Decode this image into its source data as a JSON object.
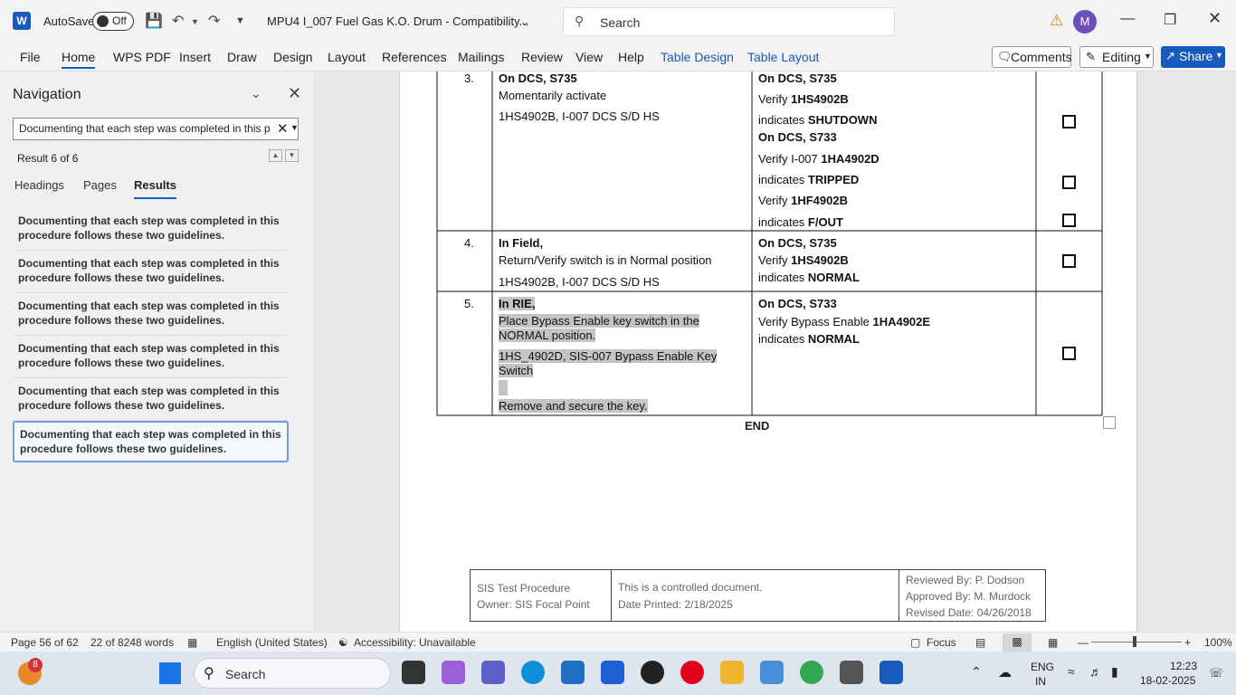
{
  "titlebar": {
    "autosave_label": "AutoSave",
    "toggle_state": "Off",
    "doc_title": "MPU4 I_007 Fuel Gas K.O. Drum  -  Compatibility...",
    "search_placeholder": "Search",
    "avatar_initial": "M"
  },
  "ribbon": {
    "tabs": [
      "File",
      "Home",
      "WPS PDF",
      "Insert",
      "Draw",
      "Design",
      "Layout",
      "References",
      "Mailings",
      "Review",
      "View",
      "Help",
      "Table Design",
      "Table Layout"
    ],
    "comments_label": "Comments",
    "editing_label": "Editing",
    "share_label": "Share"
  },
  "navigation": {
    "title": "Navigation",
    "search_value": "Documenting that each step was completed in this p",
    "result_count": "Result 6 of 6",
    "tabs": [
      "Headings",
      "Pages",
      "Results"
    ],
    "results": [
      "Documenting that each step was completed in this procedure follows these two guidelines.",
      "Documenting that each step was completed in this procedure follows these two guidelines.",
      "Documenting that each step was completed in this procedure follows these two guidelines.",
      "Documenting that each step was completed in this procedure follows these two guidelines.",
      "Documenting that each step was completed in this procedure follows these two guidelines.",
      "Documenting that each step was completed in this procedure follows these two guidelines."
    ]
  },
  "document": {
    "rows": [
      {
        "num": "3.",
        "action": [
          "On DCS, S735",
          "Momentarily activate",
          "1HS4902B, I-007 DCS S/D HS"
        ],
        "verify": [
          "On DCS, S735",
          "Verify ",
          "1HS4902B",
          " indicates ",
          "SHUTDOWN",
          "On DCS, S733",
          "Verify I-007 ",
          "1HA4902D",
          " indicates ",
          "TRIPPED",
          "Verify ",
          "1HF4902B",
          " indicates ",
          "F/OUT"
        ]
      },
      {
        "num": "4.",
        "action": [
          "In Field,",
          "Return/Verify switch is in Normal position",
          "1HS4902B, I-007 DCS S/D HS"
        ],
        "verify": [
          "On DCS, S735",
          "Verify ",
          "1HS4902B",
          " indicates ",
          "NORMAL"
        ]
      },
      {
        "num": "5.",
        "action": [
          "In RIE,",
          "Place Bypass Enable key switch in the",
          "NORMAL position.",
          "1HS_4902D, SIS-007 Bypass Enable Key",
          "Switch",
          "Remove and secure the key."
        ],
        "verify": [
          "On DCS, S733",
          "Verify Bypass Enable ",
          "1HA4902E",
          " indicates ",
          "NORMAL"
        ]
      }
    ],
    "end_label": "END",
    "footer": {
      "left": [
        "SIS Test Procedure",
        "Owner: SIS Focal Point"
      ],
      "middle": [
        "This is a controlled document.",
        "Date Printed: 2/18/2025"
      ],
      "right": [
        "Reviewed By: P. Dodson",
        "Approved By: M. Murdock",
        "Revised Date: 04/26/2018"
      ]
    }
  },
  "statusbar": {
    "page": "Page 56 of 62",
    "words": "22 of 8248 words",
    "language": "English (United States)",
    "accessibility": "Accessibility: Unavailable",
    "focus": "Focus",
    "zoom": "100%"
  },
  "taskbar": {
    "search_placeholder": "Search",
    "notification_count": "8",
    "lang_line1": "ENG",
    "lang_line2": "IN",
    "time": "12:23",
    "date": "18-02-2025"
  },
  "colors": {
    "accent": "#185abd",
    "highlight": "#c4c4c4",
    "warning": "#d48a00"
  }
}
